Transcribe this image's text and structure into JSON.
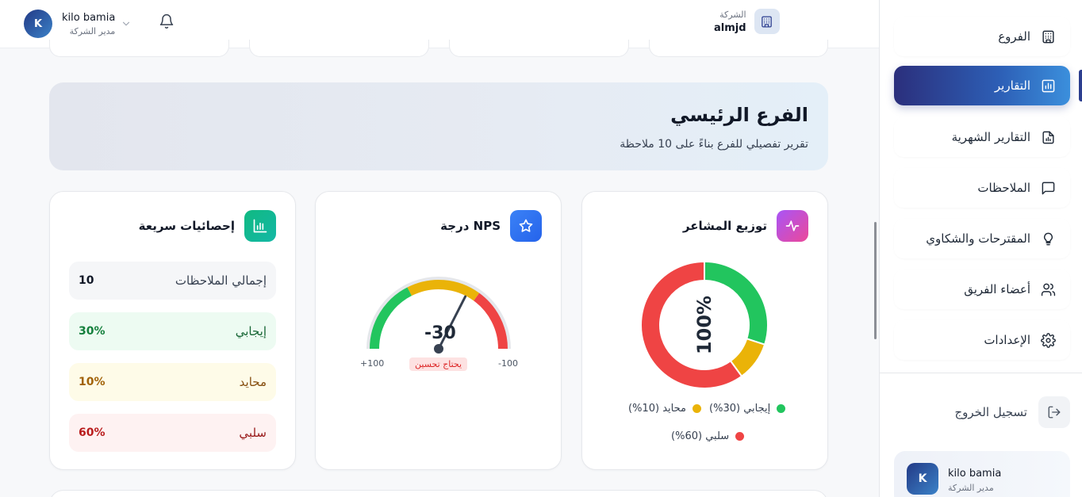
{
  "header": {
    "user": {
      "initial": "K",
      "name": "kilo bamia",
      "role": "مدير الشركة"
    },
    "company": {
      "label": "الشركة",
      "name": "almjd"
    }
  },
  "sidebar": {
    "items": [
      {
        "label": "الفروع",
        "icon": "building-icon",
        "active": false
      },
      {
        "label": "التقارير",
        "icon": "bar-chart-icon",
        "active": true
      },
      {
        "label": "التقارير الشهرية",
        "icon": "file-chart-icon",
        "active": false
      },
      {
        "label": "الملاحظات",
        "icon": "message-icon",
        "active": false
      },
      {
        "label": "المقترحات والشكاوي",
        "icon": "lightbulb-icon",
        "active": false
      },
      {
        "label": "أعضاء الفريق",
        "icon": "users-icon",
        "active": false
      },
      {
        "label": "الإعدادات",
        "icon": "gear-icon",
        "active": false
      }
    ],
    "logout_label": "تسجيل الخروج",
    "profile": {
      "initial": "K",
      "name": "kilo bamia",
      "role": "مدير الشركة"
    }
  },
  "banner": {
    "title": "الفرع الرئيسي",
    "subtitle": "تقرير تفصيلي للفرع بناءً على 10 ملاحظة"
  },
  "sentiment_card": {
    "title": "توزيع المشاعر",
    "center_label": "100%",
    "legend": [
      {
        "label": "إيجابي (30%)",
        "color": "#22c55e"
      },
      {
        "label": "محايد (10%)",
        "color": "#eab308"
      },
      {
        "label": "سلبي (60%)",
        "color": "#ef4444"
      }
    ]
  },
  "nps_card": {
    "title": "درجة NPS",
    "score_text": "-30",
    "min_label": "-100",
    "max_label": "+100",
    "status_badge": "يحتاج تحسين"
  },
  "stats_card": {
    "title": "إحصائيات سريعة",
    "rows": [
      {
        "label": "إجمالي الملاحظات",
        "value": "10",
        "bg": "#f5f6f8",
        "color": "#111827",
        "label_color": "#374151"
      },
      {
        "label": "إيجابي",
        "value": "30%",
        "bg": "#edfbf2",
        "color": "#15803d",
        "label_color": "#166534"
      },
      {
        "label": "محايد",
        "value": "10%",
        "bg": "#fefbe8",
        "color": "#a16207",
        "label_color": "#854d0e"
      },
      {
        "label": "سلبي",
        "value": "60%",
        "bg": "#fef2f2",
        "color": "#b91c1c",
        "label_color": "#991b1b"
      }
    ]
  },
  "chart_data": [
    {
      "type": "pie",
      "title": "توزيع المشاعر",
      "categories": [
        "إيجابي",
        "محايد",
        "سلبي"
      ],
      "values": [
        30,
        10,
        60
      ],
      "colors": [
        "#22c55e",
        "#eab308",
        "#ef4444"
      ],
      "legend": "bottom"
    },
    {
      "type": "gauge",
      "title": "درجة NPS",
      "value": -30,
      "ylim": [
        -100,
        100
      ],
      "zones": [
        {
          "range": [
            -100,
            -40
          ],
          "color": "#ef4444"
        },
        {
          "range": [
            -40,
            30
          ],
          "color": "#eab308"
        },
        {
          "range": [
            30,
            100
          ],
          "color": "#22c55e"
        }
      ]
    }
  ]
}
